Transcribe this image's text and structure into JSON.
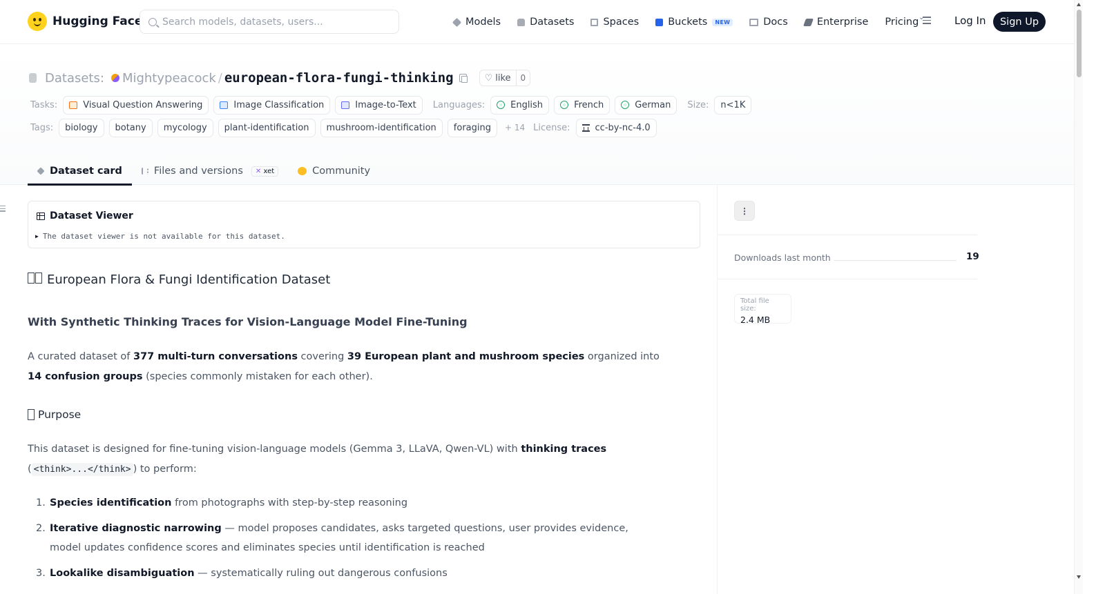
{
  "nav": {
    "brand": "Hugging Face",
    "search_placeholder": "Search models, datasets, users...",
    "links": [
      {
        "label": "Models",
        "icon": "models-icon"
      },
      {
        "label": "Datasets",
        "icon": "datasets-icon"
      },
      {
        "label": "Spaces",
        "icon": "spaces-icon"
      },
      {
        "label": "Buckets",
        "icon": "buckets-icon",
        "badge": "NEW"
      },
      {
        "label": "Docs",
        "icon": "docs-icon"
      },
      {
        "label": "Enterprise",
        "icon": "enterprise-icon"
      },
      {
        "label": "Pricing"
      }
    ],
    "login": "Log In",
    "signup": "Sign Up"
  },
  "header": {
    "section_label": "Datasets:",
    "author": "Mightypeacock",
    "separator": "/",
    "repo": "european-flora-fungi-thinking",
    "like_label": "like",
    "like_count": "0",
    "tasks_label": "Tasks:",
    "tasks": [
      "Visual Question Answering",
      "Image Classification",
      "Image-to-Text"
    ],
    "languages_label": "Languages:",
    "languages": [
      "English",
      "French",
      "German"
    ],
    "size_label": "Size:",
    "size": "n<1K",
    "tags_label": "Tags:",
    "tags": [
      "biology",
      "botany",
      "mycology",
      "plant-identification",
      "mushroom-identification",
      "foraging"
    ],
    "more_tags": "+ 14",
    "license_label": "License:",
    "license": "cc-by-nc-4.0"
  },
  "tabs": {
    "dataset_card": "Dataset card",
    "files": "Files and versions",
    "xet_badge": "xet",
    "community": "Community"
  },
  "viewer": {
    "title": "Dataset Viewer",
    "message": "The dataset viewer is not available for this dataset."
  },
  "card": {
    "title": "European Flora & Fungi Identification Dataset",
    "subtitle": "With Synthetic Thinking Traces for Vision-Language Model Fine-Tuning",
    "intro": {
      "t1": "A curated dataset of ",
      "b1": "377 multi-turn conversations",
      "t2": " covering ",
      "b2": "39 European plant and mushroom species",
      "t3": " organized into ",
      "b3": "14 confusion groups",
      "t4": " (species commonly mistaken for each other)."
    },
    "purpose_heading": "Purpose",
    "purpose": {
      "t1": "This dataset is designed for fine-tuning vision-language models (Gemma 3, LLaVA, Qwen-VL) with ",
      "b1": "thinking traces",
      "t2": " (",
      "code": "<think>...</think>",
      "t3": ") to perform:"
    },
    "list": [
      {
        "num": "1.",
        "bold": "Species identification",
        "text": " from photographs with step-by-step reasoning"
      },
      {
        "num": "2.",
        "bold": "Iterative diagnostic narrowing",
        "text": " — model proposes candidates, asks targeted questions, user provides evidence, model updates confidence scores and eliminates species until identification is reached"
      },
      {
        "num": "3.",
        "bold": "Lookalike disambiguation",
        "text": " — systematically ruling out dangerous confusions"
      }
    ]
  },
  "sidebar": {
    "downloads_label": "Downloads last month",
    "downloads_value": "19",
    "file_size_label": "Total file size:",
    "file_size_value": "2.4 MB"
  }
}
